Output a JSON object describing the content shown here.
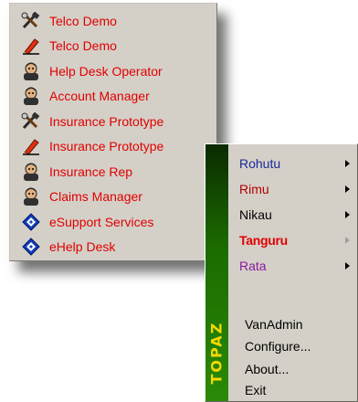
{
  "popup_menu": {
    "items": [
      {
        "label": "Telco Demo",
        "icon": "hammer-wrench-icon"
      },
      {
        "label": "Telco Demo",
        "icon": "pencil-icon"
      },
      {
        "label": "Help Desk Operator",
        "icon": "person-icon"
      },
      {
        "label": "Account Manager",
        "icon": "person-icon"
      },
      {
        "label": "Insurance Prototype",
        "icon": "hammer-wrench-icon"
      },
      {
        "label": "Insurance Prototype",
        "icon": "pencil-icon"
      },
      {
        "label": "Insurance Rep",
        "icon": "person-icon"
      },
      {
        "label": "Claims Manager",
        "icon": "person-icon"
      },
      {
        "label": "eSupport Services",
        "icon": "blue-diamond-icon"
      },
      {
        "label": "eHelp Desk",
        "icon": "blue-diamond-icon"
      }
    ],
    "text_color": "#e10000"
  },
  "start_menu": {
    "brand": "TOPAZ",
    "brand_color": "#f4d800",
    "submenus": [
      {
        "label": "Rohutu",
        "color": "#1a2a9a"
      },
      {
        "label": "Rimu",
        "color": "#b00000"
      },
      {
        "label": "Nikau",
        "color": "#000000"
      },
      {
        "label": "Tanguru",
        "color": "#e00000",
        "bold": true,
        "active": true
      },
      {
        "label": "Rata",
        "color": "#8a1aa0"
      }
    ],
    "commands": [
      {
        "label": "VanAdmin"
      },
      {
        "label": "Configure..."
      },
      {
        "label": "About..."
      },
      {
        "label": "Exit"
      }
    ]
  }
}
